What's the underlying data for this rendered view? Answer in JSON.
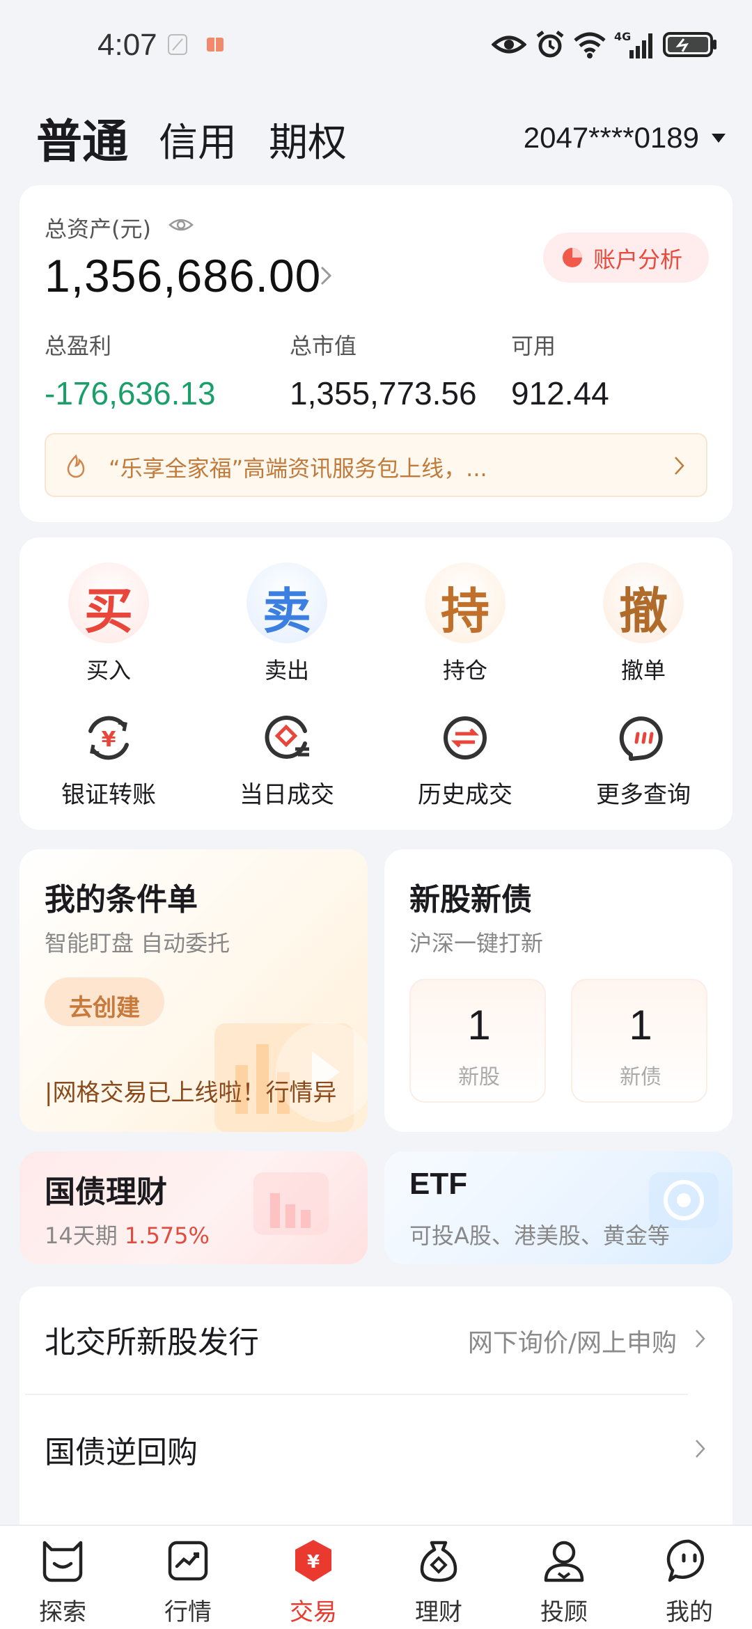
{
  "status_bar": {
    "time": "4:07",
    "icons": [
      "leaf-icon",
      "book-icon",
      "eye-icon",
      "alarm-icon",
      "wifi-icon",
      "signal-4g-icon",
      "battery-icon"
    ]
  },
  "header": {
    "tabs": [
      {
        "label": "普通",
        "active": true
      },
      {
        "label": "信用",
        "active": false
      },
      {
        "label": "期权",
        "active": false
      }
    ],
    "account_number": "2047****0189"
  },
  "assets": {
    "total_label": "总资产(元)",
    "total_value": "1,356,686.00",
    "analysis_button": "账户分析",
    "stats": [
      {
        "label": "总盈利",
        "value": "-176,636.13"
      },
      {
        "label": "总市值",
        "value": "1,355,773.56"
      },
      {
        "label": "可用",
        "value": "912.44"
      }
    ],
    "notice": "“乐享全家福”高端资讯服务包上线，..."
  },
  "actions": {
    "primary": [
      {
        "glyph": "买",
        "label": "买入",
        "color": "#e8463a"
      },
      {
        "glyph": "卖",
        "label": "卖出",
        "color": "#3b7fe0"
      },
      {
        "glyph": "持",
        "label": "持仓",
        "color": "#c0702a"
      },
      {
        "glyph": "撤",
        "label": "撤单",
        "color": "#b06a2a"
      }
    ],
    "secondary": [
      {
        "label": "银证转账",
        "icon": "bank-transfer-icon"
      },
      {
        "label": "当日成交",
        "icon": "today-deal-icon"
      },
      {
        "label": "历史成交",
        "icon": "history-deal-icon"
      },
      {
        "label": "更多查询",
        "icon": "more-query-icon"
      }
    ]
  },
  "condition_order": {
    "title": "我的条件单",
    "subtitle": "智能盯盘 自动委托",
    "button": "去创建",
    "marquee": "|网格交易已上线啦！行情异"
  },
  "new_issues": {
    "title": "新股新债",
    "subtitle": "沪深一键打新",
    "items": [
      {
        "count": "1",
        "label": "新股"
      },
      {
        "count": "1",
        "label": "新债"
      }
    ]
  },
  "treasury": {
    "title": "国债理财",
    "term": "14天期",
    "rate": "1.575%"
  },
  "etf": {
    "title": "ETF",
    "subtitle": "可投A股、港美股、黄金等"
  },
  "list": [
    {
      "title": "北交所新股发行",
      "extra": "网下询价/网上申购"
    },
    {
      "title": "国债逆回购",
      "extra": ""
    }
  ],
  "bottom_nav": [
    {
      "label": "探索",
      "icon": "explore-icon",
      "active": false
    },
    {
      "label": "行情",
      "icon": "market-icon",
      "active": false
    },
    {
      "label": "交易",
      "icon": "trade-icon",
      "active": true
    },
    {
      "label": "理财",
      "icon": "wealth-icon",
      "active": false
    },
    {
      "label": "投顾",
      "icon": "advisor-icon",
      "active": false
    },
    {
      "label": "我的",
      "icon": "profile-icon",
      "active": false
    }
  ]
}
